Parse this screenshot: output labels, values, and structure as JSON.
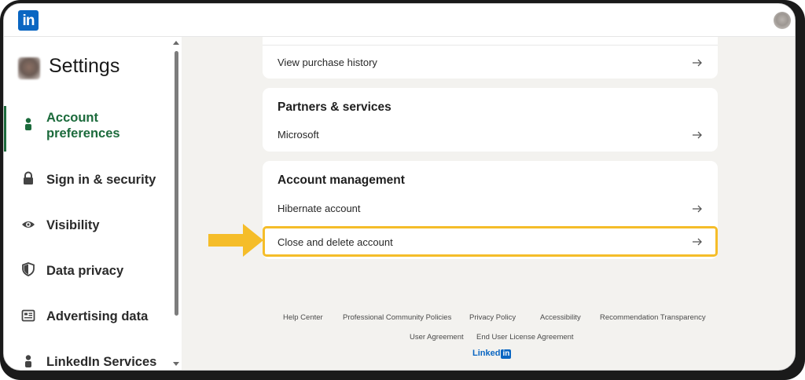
{
  "app": {
    "logo_text": "in",
    "brand": "LinkedIn"
  },
  "sidebar": {
    "title": "Settings",
    "items": [
      {
        "label": "Account\npreferences",
        "line1": "Account",
        "line2": "preferences",
        "icon": "person-icon",
        "active": true
      },
      {
        "label": "Sign in & security",
        "icon": "lock-icon"
      },
      {
        "label": "Visibility",
        "icon": "eye-icon"
      },
      {
        "label": "Data privacy",
        "icon": "shield-icon"
      },
      {
        "label": "Advertising data",
        "icon": "newspaper-icon"
      },
      {
        "label": "LinkedIn Services",
        "icon": "person-icon"
      }
    ]
  },
  "main": {
    "purchase_row": "View purchase history",
    "partners": {
      "title": "Partners & services",
      "rows": [
        "Microsoft"
      ]
    },
    "account_management": {
      "title": "Account management",
      "rows": [
        "Hibernate account",
        "Close and delete account"
      ]
    }
  },
  "footer": {
    "row1": [
      "Help Center",
      "Professional Community Policies",
      "Privacy Policy",
      "Accessibility",
      "Recommendation Transparency"
    ],
    "row2": [
      "User Agreement",
      "End User License Agreement"
    ],
    "logo_word": "Linked",
    "logo_in": "in"
  },
  "colors": {
    "accent_green": "#1c6b3c",
    "brand_blue": "#0a66c2",
    "highlight": "#f5bd29"
  }
}
